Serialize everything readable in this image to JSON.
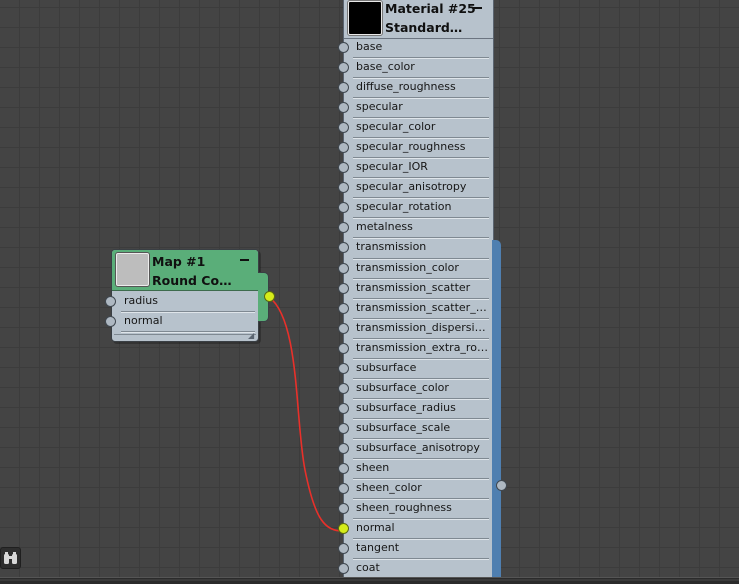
{
  "material_node": {
    "title_line1": "Material #25",
    "title_line2": "Standard…",
    "minimize_label": "—",
    "inputs": [
      {
        "label": "base"
      },
      {
        "label": "base_color"
      },
      {
        "label": "diffuse_roughness"
      },
      {
        "label": "specular"
      },
      {
        "label": "specular_color"
      },
      {
        "label": "specular_roughness"
      },
      {
        "label": "specular_IOR"
      },
      {
        "label": "specular_anisotropy"
      },
      {
        "label": "specular_rotation"
      },
      {
        "label": "metalness"
      },
      {
        "label": "transmission"
      },
      {
        "label": "transmission_color"
      },
      {
        "label": "transmission_scatter"
      },
      {
        "label": "transmission_scatter_ani…"
      },
      {
        "label": "transmission_dispersion"
      },
      {
        "label": "transmission_extra_roug…"
      },
      {
        "label": "subsurface"
      },
      {
        "label": "subsurface_color"
      },
      {
        "label": "subsurface_radius"
      },
      {
        "label": "subsurface_scale"
      },
      {
        "label": "subsurface_anisotropy"
      },
      {
        "label": "sheen"
      },
      {
        "label": "sheen_color"
      },
      {
        "label": "sheen_roughness"
      },
      {
        "label": "normal",
        "linked": true
      },
      {
        "label": "tangent"
      },
      {
        "label": "coat"
      }
    ]
  },
  "map_node": {
    "title_line1": "Map #1",
    "title_line2": "Round Co…",
    "inputs": [
      {
        "label": "radius"
      },
      {
        "label": "normal"
      }
    ]
  },
  "colors": {
    "canvas": "#444444",
    "node_body": "#b7c2cc",
    "map_header": "#5aae79",
    "material_output_strip": "#4f7fb0",
    "linked_socket": "#d5ec1a",
    "wire": "#e8302a"
  },
  "icons": {
    "navigator": "binoculars-icon"
  }
}
